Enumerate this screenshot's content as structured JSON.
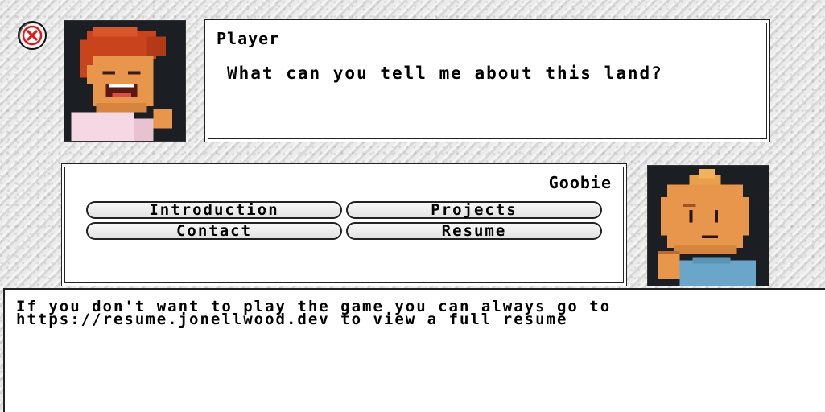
{
  "close": {
    "icon": "close-x-icon",
    "color": "#e01818"
  },
  "player": {
    "name": "Player",
    "line": "What can you tell me about this land?",
    "portrait": "player-portrait"
  },
  "npc": {
    "name": "Goobie",
    "portrait": "goobie-portrait",
    "choices": [
      "Introduction",
      "Projects",
      "Contact",
      "Resume"
    ]
  },
  "console": {
    "lines": [
      "If you don't want to play the game you can always go to",
      "https://resume.jonellwood.dev to view a full resume"
    ]
  }
}
